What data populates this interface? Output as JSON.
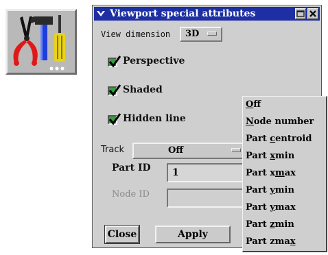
{
  "tool_icon": {
    "name": "tools-icon"
  },
  "dialog": {
    "title": "Viewport special attributes",
    "view_dimension_label": "View dimension",
    "view_dimension_value": "3D",
    "checkboxes": [
      {
        "label": "Perspective",
        "checked": true
      },
      {
        "label": "Shaded",
        "checked": true
      },
      {
        "label": "Hidden line",
        "checked": true
      }
    ],
    "track_label": "Track",
    "track_value": "Off",
    "part_id_label": "Part ID",
    "part_id_value": "1",
    "node_id_label": "Node ID",
    "node_id_value": "",
    "close_label": "Close",
    "apply_label": "Apply"
  },
  "track_menu": {
    "items": [
      {
        "pre": "",
        "u": "O",
        "post": "ff"
      },
      {
        "pre": "",
        "u": "N",
        "post": "ode number"
      },
      {
        "pre": "Part ",
        "u": "c",
        "post": "entroid"
      },
      {
        "pre": "Part ",
        "u": "x",
        "post": "min"
      },
      {
        "pre": "Part x",
        "u": "m",
        "post": "ax"
      },
      {
        "pre": "Part ",
        "u": "y",
        "post": "min"
      },
      {
        "pre": "Part ",
        "u": "y",
        "post": "max"
      },
      {
        "pre": "Part ",
        "u": "z",
        "post": "min"
      },
      {
        "pre": "Part zma",
        "u": "x",
        "post": ""
      }
    ]
  },
  "colors": {
    "titlebar": "#1d2fa3",
    "window_bg": "#cfcfcf",
    "check_green": "#2fa33a"
  }
}
